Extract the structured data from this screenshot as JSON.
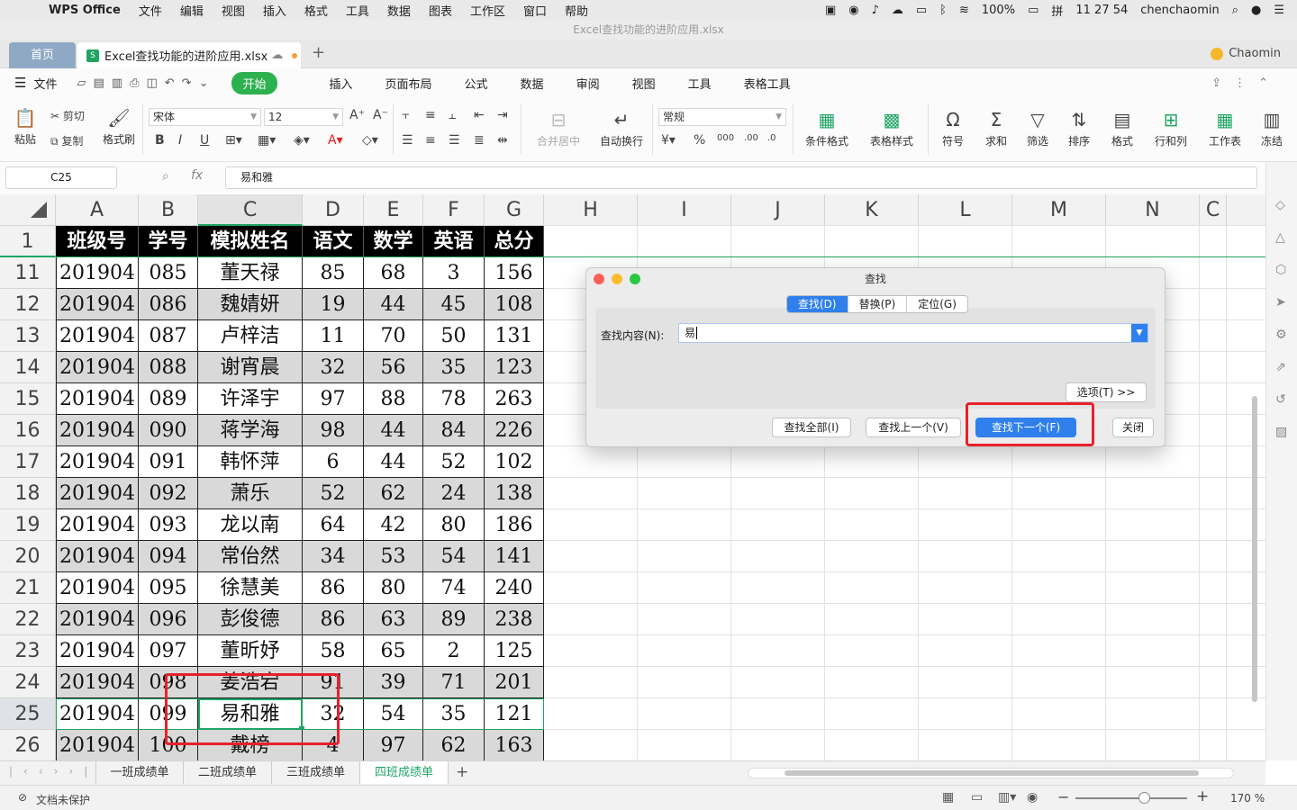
{
  "menubar": {
    "app": "WPS Office",
    "items": [
      "文件",
      "编辑",
      "视图",
      "插入",
      "格式",
      "工具",
      "数据",
      "图表",
      "工作区",
      "窗口",
      "帮助"
    ],
    "battery": "100%",
    "clock": "11 27 54",
    "user": "chenchaomin"
  },
  "window": {
    "title": "Excel查找功能的进阶应用.xlsx"
  },
  "tabs": {
    "home": "首页",
    "doc": "Excel查找功能的进阶应用.xlsx",
    "user": "Chaomin"
  },
  "ribbon_tabs": {
    "file": "文件",
    "items": [
      "开始",
      "插入",
      "页面布局",
      "公式",
      "数据",
      "审阅",
      "视图",
      "工具",
      "表格工具"
    ]
  },
  "ribbon": {
    "paste": "粘贴",
    "cut": "剪切",
    "copy": "复制",
    "format_painter": "格式刷",
    "font": "宋体",
    "size": "12",
    "merge": "合并居中",
    "wrap": "自动换行",
    "number_format": "常规",
    "cond_format": "条件格式",
    "table_style": "表格样式",
    "symbol": "符号",
    "sum": "求和",
    "filter": "筛选",
    "sort": "排序",
    "format": "格式",
    "rowcol": "行和列",
    "sheet": "工作表",
    "freeze": "冻结"
  },
  "formula_bar": {
    "name_box": "C25",
    "fx": "fx",
    "value": "易和雅"
  },
  "columns": [
    "A",
    "B",
    "C",
    "D",
    "E",
    "F",
    "G",
    "H",
    "I",
    "J",
    "K",
    "L",
    "M",
    "N",
    "C"
  ],
  "table": {
    "headers": [
      "班级号",
      "学号",
      "模拟姓名",
      "语文",
      "数学",
      "英语",
      "总分"
    ],
    "row_numbers": [
      "1",
      "11",
      "12",
      "13",
      "14",
      "15",
      "16",
      "17",
      "18",
      "19",
      "20",
      "21",
      "22",
      "23",
      "24",
      "25",
      "26"
    ],
    "rows": [
      [
        "201904",
        "085",
        "董天禄",
        "85",
        "68",
        "3",
        "156"
      ],
      [
        "201904",
        "086",
        "魏婧妍",
        "19",
        "44",
        "45",
        "108"
      ],
      [
        "201904",
        "087",
        "卢梓洁",
        "11",
        "70",
        "50",
        "131"
      ],
      [
        "201904",
        "088",
        "谢宵晨",
        "32",
        "56",
        "35",
        "123"
      ],
      [
        "201904",
        "089",
        "许泽宇",
        "97",
        "88",
        "78",
        "263"
      ],
      [
        "201904",
        "090",
        "蒋学海",
        "98",
        "44",
        "84",
        "226"
      ],
      [
        "201904",
        "091",
        "韩怀萍",
        "6",
        "44",
        "52",
        "102"
      ],
      [
        "201904",
        "092",
        "萧乐",
        "52",
        "62",
        "24",
        "138"
      ],
      [
        "201904",
        "093",
        "龙以南",
        "64",
        "42",
        "80",
        "186"
      ],
      [
        "201904",
        "094",
        "常佁然",
        "34",
        "53",
        "54",
        "141"
      ],
      [
        "201904",
        "095",
        "徐慧美",
        "86",
        "80",
        "74",
        "240"
      ],
      [
        "201904",
        "096",
        "彭俊德",
        "86",
        "63",
        "89",
        "238"
      ],
      [
        "201904",
        "097",
        "董昕妤",
        "58",
        "65",
        "2",
        "125"
      ],
      [
        "201904",
        "098",
        "姜浩宕",
        "91",
        "39",
        "71",
        "201"
      ],
      [
        "201904",
        "099",
        "易和雅",
        "32",
        "54",
        "35",
        "121"
      ],
      [
        "201904",
        "100",
        "戴榜",
        "4",
        "97",
        "62",
        "163"
      ]
    ]
  },
  "dialog": {
    "title": "查找",
    "tabs": [
      "查找(D)",
      "替换(P)",
      "定位(G)"
    ],
    "find_label": "查找内容(N):",
    "find_value": "易",
    "options": "选项(T) >>",
    "find_all": "查找全部(I)",
    "find_prev": "查找上一个(V)",
    "find_next": "查找下一个(F)",
    "close": "关闭"
  },
  "sheets": [
    "一班成绩单",
    "二班成绩单",
    "三班成绩单",
    "四班成绩单"
  ],
  "status": {
    "protect": "文档未保护",
    "zoom": "170 %"
  },
  "colors": {
    "accent": "#2db14f",
    "blue": "#2f80ed",
    "highlight": "#e8202b"
  }
}
